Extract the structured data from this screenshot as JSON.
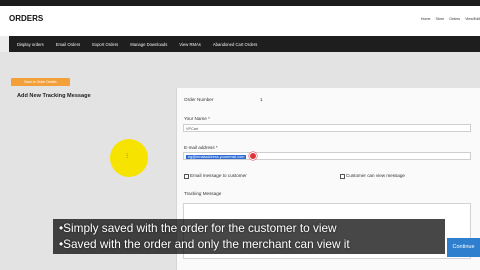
{
  "app": {
    "title": "ORDERS",
    "top_nav": [
      "Home",
      "Store",
      "Orders",
      "View/Edit"
    ]
  },
  "menu": {
    "items": [
      "Display orders",
      "Email Orders",
      "Export Orders",
      "Manage Downloads",
      "View RMAs",
      "Abandoned Cart Orders"
    ]
  },
  "page": {
    "back_button_label": "Back to Order Details",
    "heading": "Add New Tracking Message"
  },
  "form": {
    "order_number_label": "Order Number",
    "order_number_value": "1",
    "your_name_label": "Your Name *",
    "your_name_value": "VPCart",
    "email_label": "E-mail address *",
    "email_value": "eg@emailaddress.youremail.com",
    "email_customer_label": "Email message to customer",
    "customer_can_view_label": "Customer can view message",
    "tracking_message_label": "Tracking Message",
    "continue_label": "Continue"
  },
  "overlay": {
    "lines": [
      "•Simply saved with the order for the customer to view",
      "•Saved with the order and only the merchant can view it"
    ]
  },
  "colors": {
    "menubar": "#1e1e1e",
    "back_button": "#f3a03a",
    "continue_button": "#2f7fcf",
    "highlight_circle": "#f6e300",
    "cursor": "#e0313e"
  }
}
